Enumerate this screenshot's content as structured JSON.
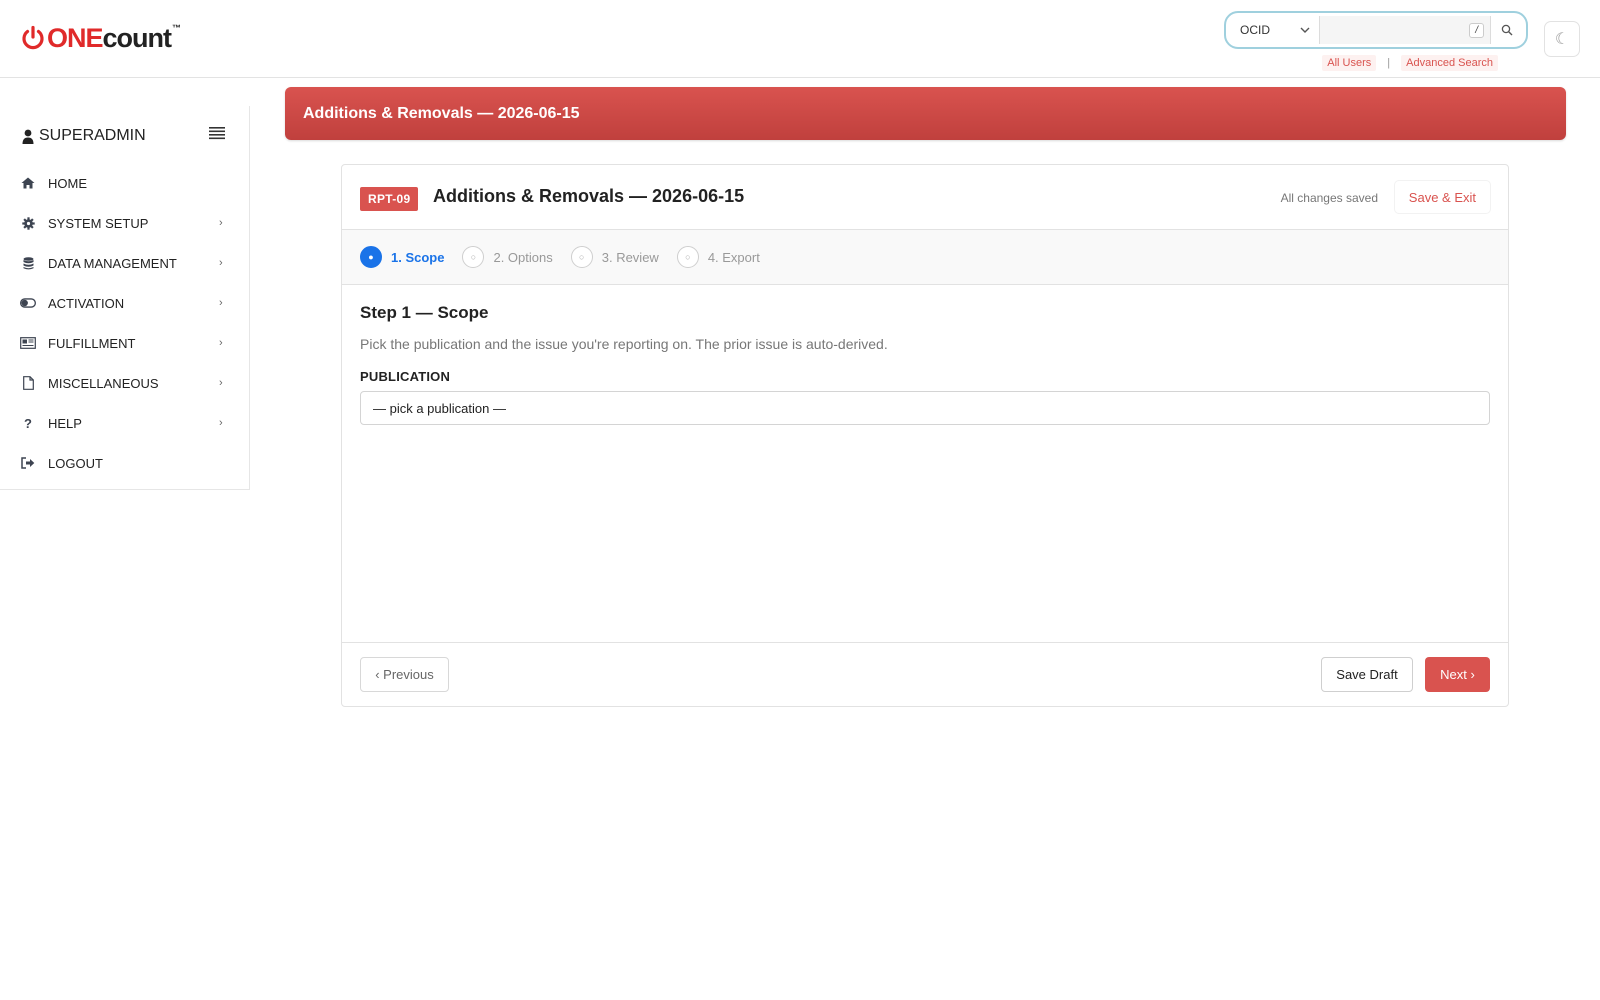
{
  "brand": {
    "one": "ONE",
    "count": "count",
    "tm": "™"
  },
  "search": {
    "select_value": "OCID",
    "shortcut": "/",
    "links": [
      "All Users",
      "Advanced Search"
    ],
    "separator": "|"
  },
  "theme_toggle": {
    "icon": "moon-icon",
    "glyph": "☾"
  },
  "sidebar": {
    "user": "SUPERADMIN",
    "items": [
      {
        "label": "HOME",
        "icon": "home-icon",
        "submenu": false
      },
      {
        "label": "SYSTEM SETUP",
        "icon": "gear-icon",
        "submenu": true
      },
      {
        "label": "DATA MANAGEMENT",
        "icon": "database-icon",
        "submenu": true
      },
      {
        "label": "ACTIVATION",
        "icon": "toggle-icon",
        "submenu": true
      },
      {
        "label": "FULFILLMENT",
        "icon": "newspaper-icon",
        "submenu": true
      },
      {
        "label": "MISCELLANEOUS",
        "icon": "file-icon",
        "submenu": true
      },
      {
        "label": "HELP",
        "icon": "question-icon",
        "submenu": true
      },
      {
        "label": "LOGOUT",
        "icon": "logout-icon",
        "submenu": false
      }
    ],
    "arrow": "›"
  },
  "banner": {
    "title": "Additions & Removals — 2026-06-15"
  },
  "card": {
    "tag": "RPT-09",
    "title": "Additions & Removals — 2026-06-15",
    "saved_status": "All changes saved",
    "save_exit": "Save & Exit",
    "steps": [
      {
        "label": "1. Scope",
        "active": true,
        "dot": "●"
      },
      {
        "label": "2. Options",
        "active": false,
        "dot": "○"
      },
      {
        "label": "3. Review",
        "active": false,
        "dot": "○"
      },
      {
        "label": "4. Export",
        "active": false,
        "dot": "○"
      }
    ],
    "step_heading": "Step 1 — Scope",
    "step_desc": "Pick the publication and the issue you're reporting on. The prior issue is auto-derived.",
    "field_label": "PUBLICATION",
    "field_value": "— pick a publication —",
    "prev": "‹ Previous",
    "save_draft": "Save Draft",
    "next": "Next ›"
  },
  "colors": {
    "accent": "#d9534f",
    "step_active": "#1a73e8",
    "search_border": "#9fd0de"
  }
}
